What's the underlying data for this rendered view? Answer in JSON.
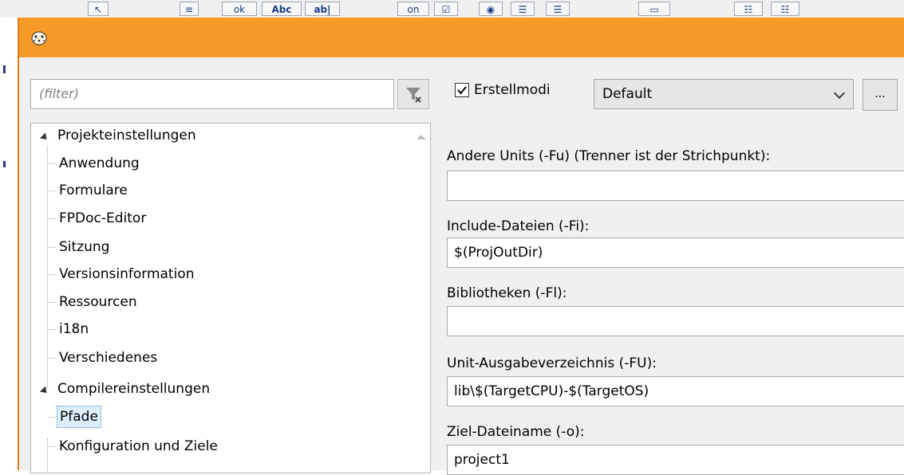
{
  "background_toolbar": {
    "buttons": [
      "ok",
      "Abc",
      "ab|",
      "on"
    ]
  },
  "dialog": {
    "title_icon": "lazarus-cheetah-icon",
    "filter": {
      "placeholder": "(filter)"
    },
    "tree": {
      "items": [
        {
          "label": "Projekteinstellungen",
          "level": 0,
          "expanded": true
        },
        {
          "label": "Anwendung",
          "level": 1
        },
        {
          "label": "Formulare",
          "level": 1
        },
        {
          "label": "FPDoc-Editor",
          "level": 1
        },
        {
          "label": "Sitzung",
          "level": 1
        },
        {
          "label": "Versionsinformation",
          "level": 1
        },
        {
          "label": "Ressourcen",
          "level": 1
        },
        {
          "label": "i18n",
          "level": 1
        },
        {
          "label": "Verschiedenes",
          "level": 1
        },
        {
          "label": "Compilereinstellungen",
          "level": 0,
          "expanded": true
        },
        {
          "label": "Pfade",
          "level": 1,
          "selected": true
        },
        {
          "label": "Konfiguration und Ziele",
          "level": 1
        }
      ]
    },
    "build_modes": {
      "checkbox_label": "Erstellmodi",
      "checked": true,
      "selected_mode": "Default",
      "more_button_label": "..."
    },
    "fields": [
      {
        "label": "Andere Units (-Fu) (Trenner ist der Strichpunkt):",
        "value": ""
      },
      {
        "label": "Include-Dateien (-Fi):",
        "value": "$(ProjOutDir)"
      },
      {
        "label": "Bibliotheken (-Fl):",
        "value": ""
      },
      {
        "label": "Unit-Ausgabeverzeichnis (-FU):",
        "value": "lib\\$(TargetCPU)-$(TargetOS)"
      },
      {
        "label": "Ziel-Dateiname (-o):",
        "value": "project1"
      }
    ],
    "colors": {
      "titlebar": "#f89a28",
      "selection": "#ddeeff"
    }
  }
}
